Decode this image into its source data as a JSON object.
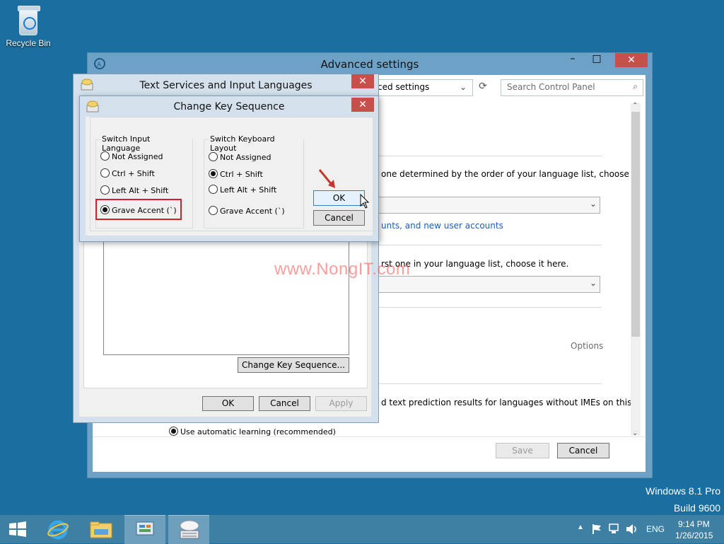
{
  "desktop": {
    "recycle_bin_label": "Recycle Bin",
    "os_name": "Windows 8.1 Pro",
    "build": "Build 9600"
  },
  "advanced_window": {
    "title": "Advanced settings",
    "address_text": "ced settings",
    "search_placeholder": "Search Control Panel",
    "text_order": "one determined by the order of your language list, choose",
    "link_text": "unts, and new user accounts",
    "text_first": "rst one in your language list, choose it here.",
    "options_link": "Options",
    "text_prediction": "d text prediction results for languages without IMEs on this",
    "auto_learning": "Use automatic learning (recommended)",
    "save_label": "Save",
    "cancel_label": "Cancel"
  },
  "text_services": {
    "title": "Text Services and Input Languages",
    "change_key_seq_button": "Change Key Sequence...",
    "ok_label": "OK",
    "cancel_label": "Cancel",
    "apply_label": "Apply"
  },
  "change_key_sequence": {
    "title": "Change Key Sequence",
    "input_language": {
      "legend": "Switch Input Language",
      "options": [
        "Not Assigned",
        "Ctrl + Shift",
        "Left Alt + Shift",
        "Grave Accent (`)"
      ],
      "selected": "Grave Accent (`)"
    },
    "keyboard_layout": {
      "legend": "Switch Keyboard Layout",
      "options": [
        "Not Assigned",
        "Ctrl + Shift",
        "Left Alt + Shift",
        "Grave Accent (`)"
      ],
      "selected": "Ctrl + Shift"
    },
    "ok_label": "OK",
    "cancel_label": "Cancel"
  },
  "watermark": "www.NongIT.com",
  "taskbar": {
    "items": [
      "start-icon",
      "internet-explorer-icon",
      "file-explorer-icon",
      "control-panel-icon",
      "text-services-icon"
    ],
    "lang": "ENG",
    "time": "9:14 PM",
    "date": "1/26/2015"
  },
  "colors": {
    "desktop": "#1a6ea0",
    "taskbar": "#3e7fa4",
    "close_button": "#c7504a",
    "highlight": "#d61f26"
  }
}
